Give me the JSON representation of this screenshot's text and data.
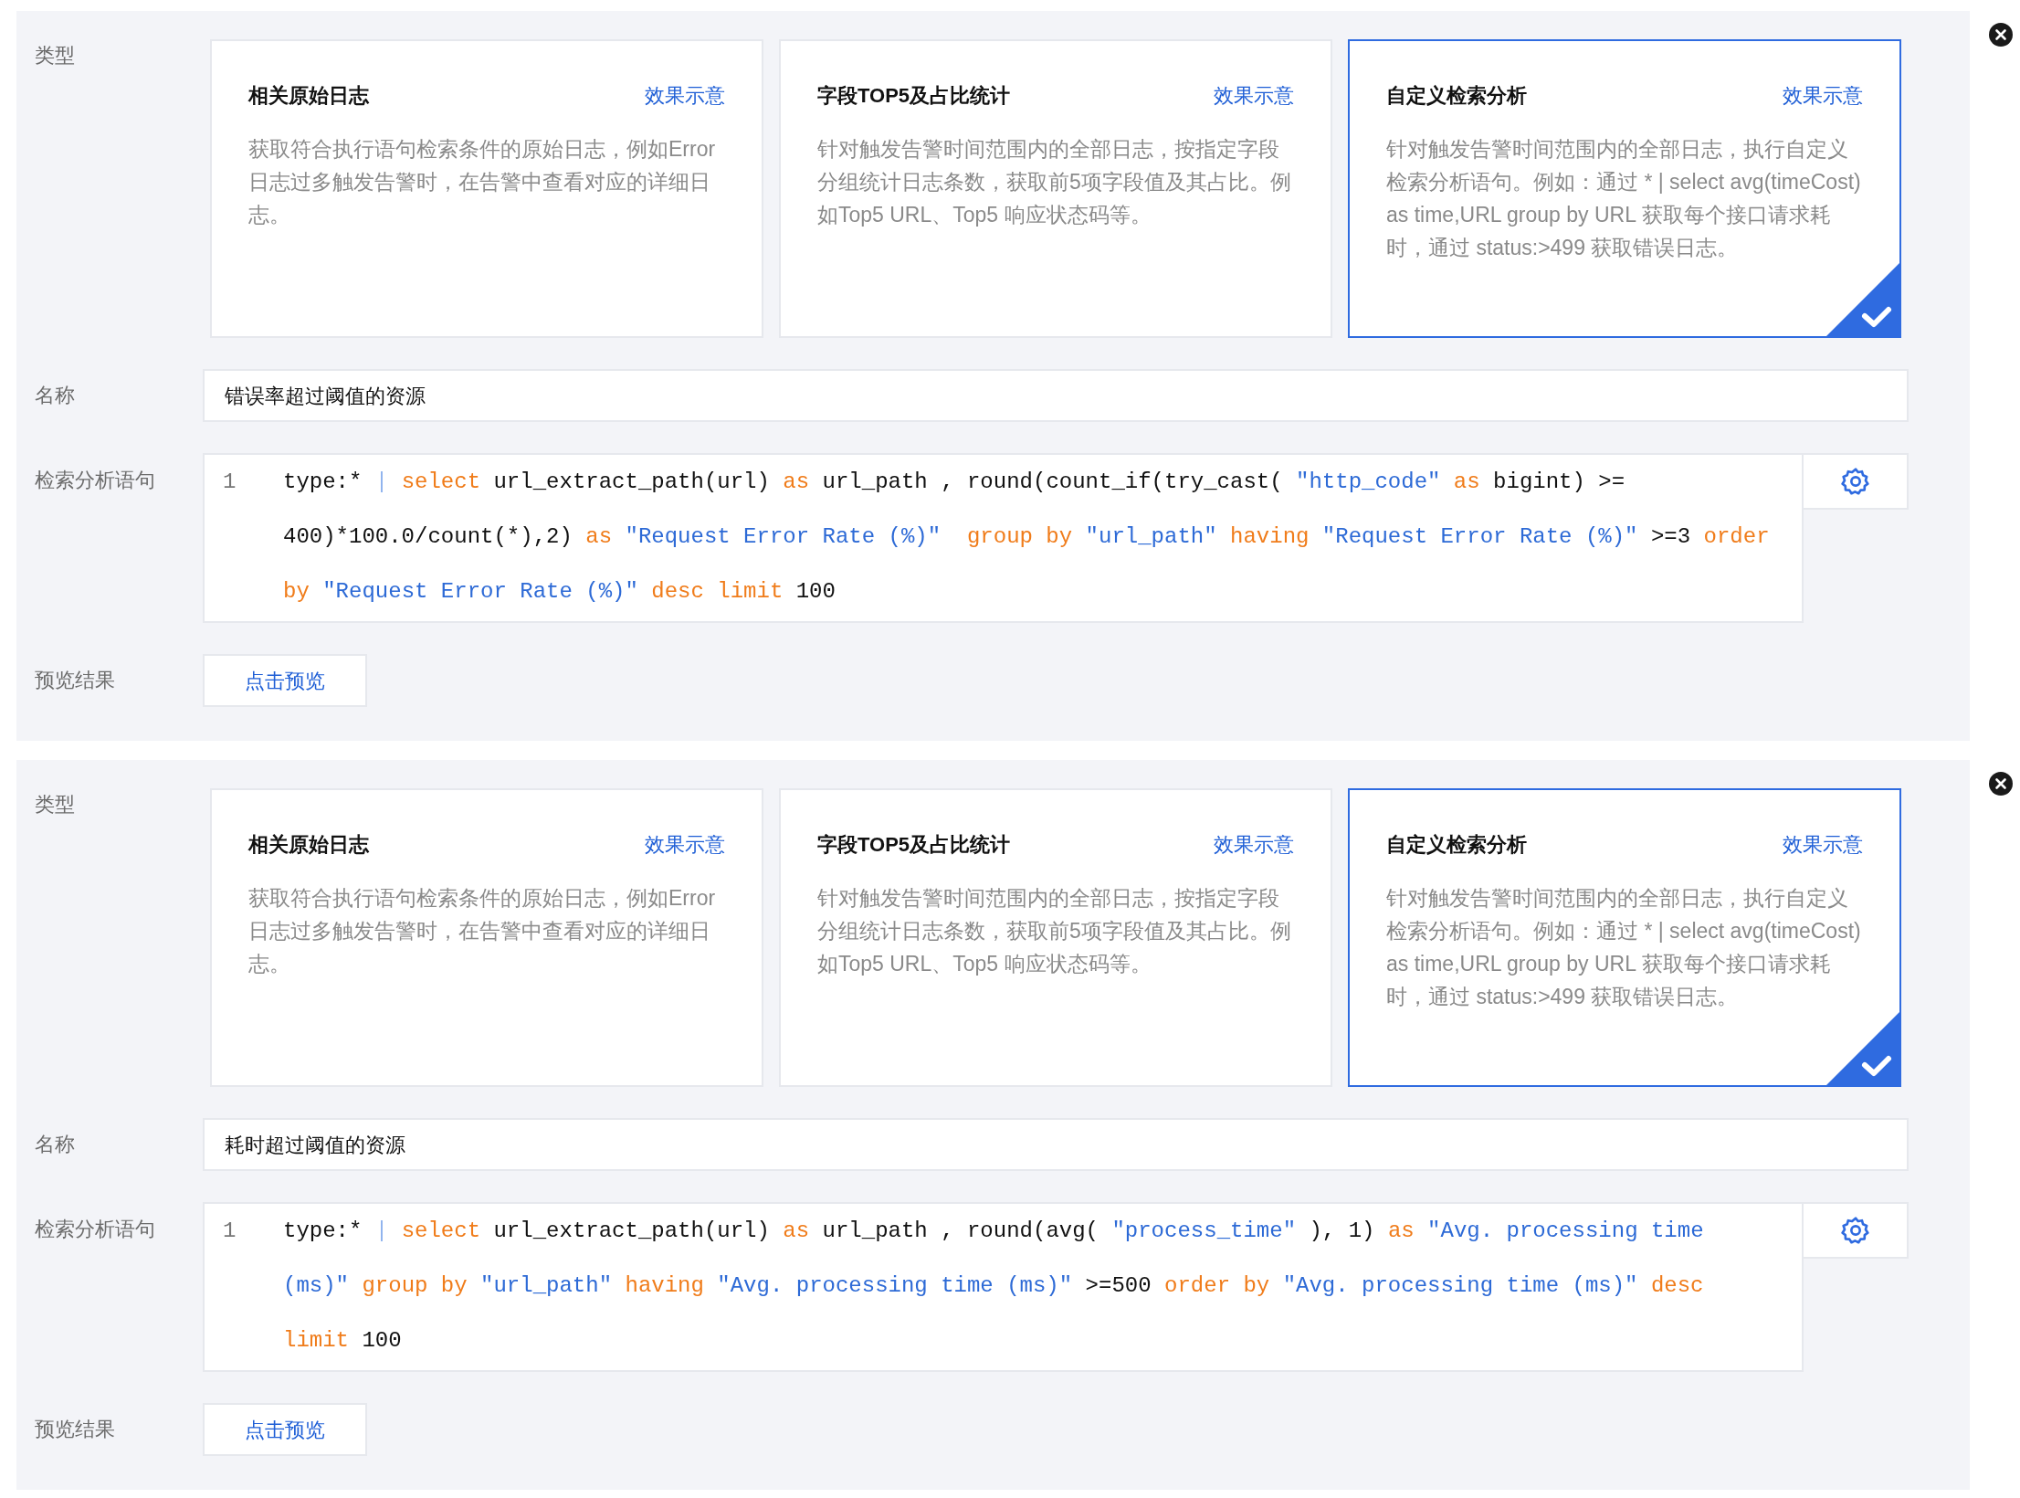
{
  "rules": [
    {
      "type_label": "类型",
      "cards": [
        {
          "title": "相关原始日志",
          "link": "效果示意",
          "description": "获取符合执行语句检索条件的原始日志，例如Error日志过多触发告警时，在告警中查看对应的详细日志。",
          "selected": false
        },
        {
          "title": "字段TOP5及占比统计",
          "link": "效果示意",
          "description": "针对触发告警时间范围内的全部日志，按指定字段分组统计日志条数，获取前5项字段值及其占比。例如Top5 URL、Top5 响应状态码等。",
          "selected": false
        },
        {
          "title": "自定义检索分析",
          "link": "效果示意",
          "description": "针对触发告警时间范围内的全部日志，执行自定义检索分析语句。例如：通过 * | select avg(timeCost) as time,URL group by URL 获取每个接口请求耗时，通过 status:>499 获取错误日志。",
          "selected": true
        }
      ],
      "name_label": "名称",
      "name_value": "错误率超过阈值的资源",
      "query_label": "检索分析语句",
      "line_number": "1",
      "query_lines": [
        [
          {
            "kind": "plain",
            "text": "type:* "
          },
          {
            "kind": "pipe",
            "text": "| "
          },
          {
            "kind": "keyword",
            "text": "select"
          },
          {
            "kind": "plain",
            "text": " url_extract_path(url) "
          },
          {
            "kind": "keyword",
            "text": "as"
          },
          {
            "kind": "plain",
            "text": " url_path , round(count_if(try_cast( "
          },
          {
            "kind": "string",
            "text": "\"http_code\" "
          },
          {
            "kind": "keyword",
            "text": "as"
          },
          {
            "kind": "plain",
            "text": " bigint) >="
          }
        ],
        [
          {
            "kind": "plain",
            "text": "400)*100.0/count(*),2) "
          },
          {
            "kind": "keyword",
            "text": "as "
          },
          {
            "kind": "string",
            "text": "\"Request Error Rate (%)\"  "
          },
          {
            "kind": "keyword",
            "text": "group by "
          },
          {
            "kind": "string",
            "text": "\"url_path\" "
          },
          {
            "kind": "keyword",
            "text": "having "
          },
          {
            "kind": "string",
            "text": "\"Request Error Rate (%)\""
          },
          {
            "kind": "plain",
            "text": " >=3 "
          },
          {
            "kind": "keyword",
            "text": "order"
          }
        ],
        [
          {
            "kind": "keyword",
            "text": "by "
          },
          {
            "kind": "string",
            "text": "\"Request Error Rate (%)\" "
          },
          {
            "kind": "keyword",
            "text": "desc limit"
          },
          {
            "kind": "plain",
            "text": " 100"
          }
        ]
      ],
      "preview_label": "预览结果",
      "preview_button": "点击预览"
    },
    {
      "type_label": "类型",
      "cards": [
        {
          "title": "相关原始日志",
          "link": "效果示意",
          "description": "获取符合执行语句检索条件的原始日志，例如Error日志过多触发告警时，在告警中查看对应的详细日志。",
          "selected": false
        },
        {
          "title": "字段TOP5及占比统计",
          "link": "效果示意",
          "description": "针对触发告警时间范围内的全部日志，按指定字段分组统计日志条数，获取前5项字段值及其占比。例如Top5 URL、Top5 响应状态码等。",
          "selected": false
        },
        {
          "title": "自定义检索分析",
          "link": "效果示意",
          "description": "针对触发告警时间范围内的全部日志，执行自定义检索分析语句。例如：通过 * | select avg(timeCost) as time,URL group by URL 获取每个接口请求耗时，通过 status:>499 获取错误日志。",
          "selected": true
        }
      ],
      "name_label": "名称",
      "name_value": "耗时超过阈值的资源",
      "query_label": "检索分析语句",
      "line_number": "1",
      "query_lines": [
        [
          {
            "kind": "plain",
            "text": "type:* "
          },
          {
            "kind": "pipe",
            "text": "| "
          },
          {
            "kind": "keyword",
            "text": "select"
          },
          {
            "kind": "plain",
            "text": " url_extract_path(url) "
          },
          {
            "kind": "keyword",
            "text": "as"
          },
          {
            "kind": "plain",
            "text": " url_path , round(avg( "
          },
          {
            "kind": "string",
            "text": "\"process_time\""
          },
          {
            "kind": "plain",
            "text": " ), 1) "
          },
          {
            "kind": "keyword",
            "text": "as "
          },
          {
            "kind": "string",
            "text": "\"Avg. processing time"
          }
        ],
        [
          {
            "kind": "string",
            "text": "(ms)\" "
          },
          {
            "kind": "keyword",
            "text": "group by "
          },
          {
            "kind": "string",
            "text": "\"url_path\" "
          },
          {
            "kind": "keyword",
            "text": "having "
          },
          {
            "kind": "string",
            "text": "\"Avg. processing time (ms)\""
          },
          {
            "kind": "plain",
            "text": " >=500 "
          },
          {
            "kind": "keyword",
            "text": "order by "
          },
          {
            "kind": "string",
            "text": "\"Avg. processing time (ms)\" "
          },
          {
            "kind": "keyword",
            "text": "desc"
          }
        ],
        [
          {
            "kind": "keyword",
            "text": "limit"
          },
          {
            "kind": "plain",
            "text": " 100"
          }
        ]
      ],
      "preview_label": "预览结果",
      "preview_button": "点击预览"
    }
  ]
}
